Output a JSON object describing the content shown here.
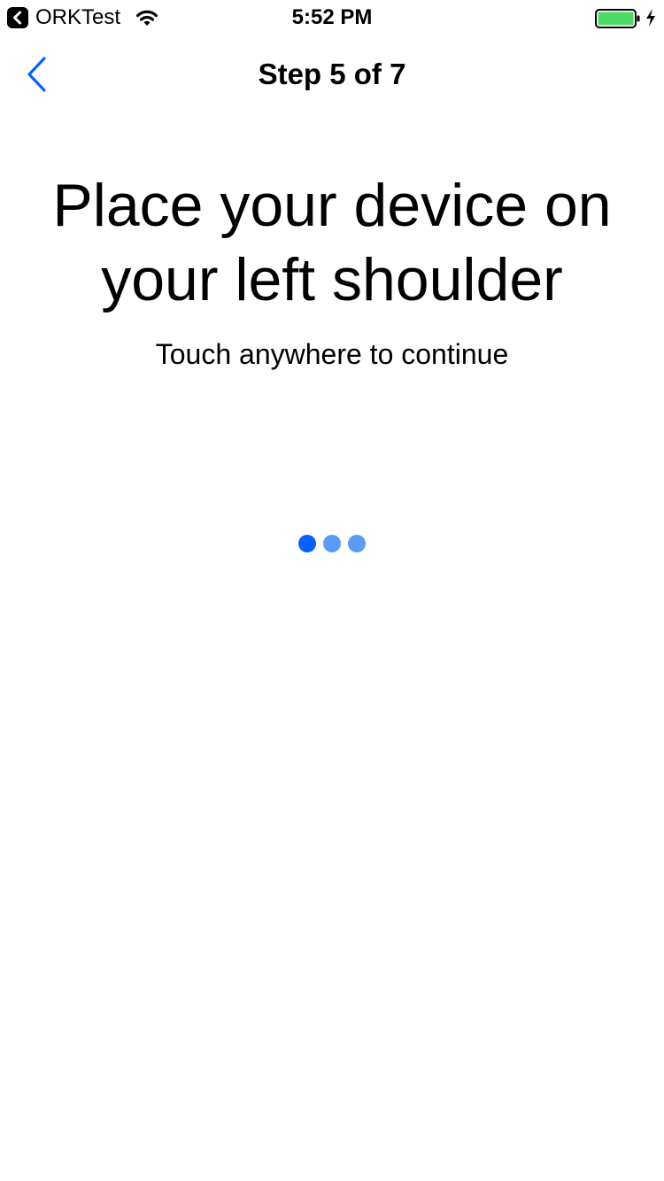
{
  "status_bar": {
    "back_app": "ORKTest",
    "time": "5:52 PM",
    "icons": [
      "back-app-icon",
      "wifi-icon",
      "battery-icon",
      "charging-icon"
    ]
  },
  "nav": {
    "title": "Step 5 of 7",
    "back_icon": "chevron-left-icon"
  },
  "content": {
    "headline": "Place your device on your left shoulder",
    "subtext": "Touch anywhere to continue"
  },
  "progress": {
    "dots": 3,
    "active_index": 0
  },
  "colors": {
    "accent": "#0a60ff",
    "dot_active": "#0a60ff",
    "dot_inactive": "#5b9cf5",
    "battery": "#4cd964",
    "background": "#ffffff",
    "text": "#000000"
  }
}
